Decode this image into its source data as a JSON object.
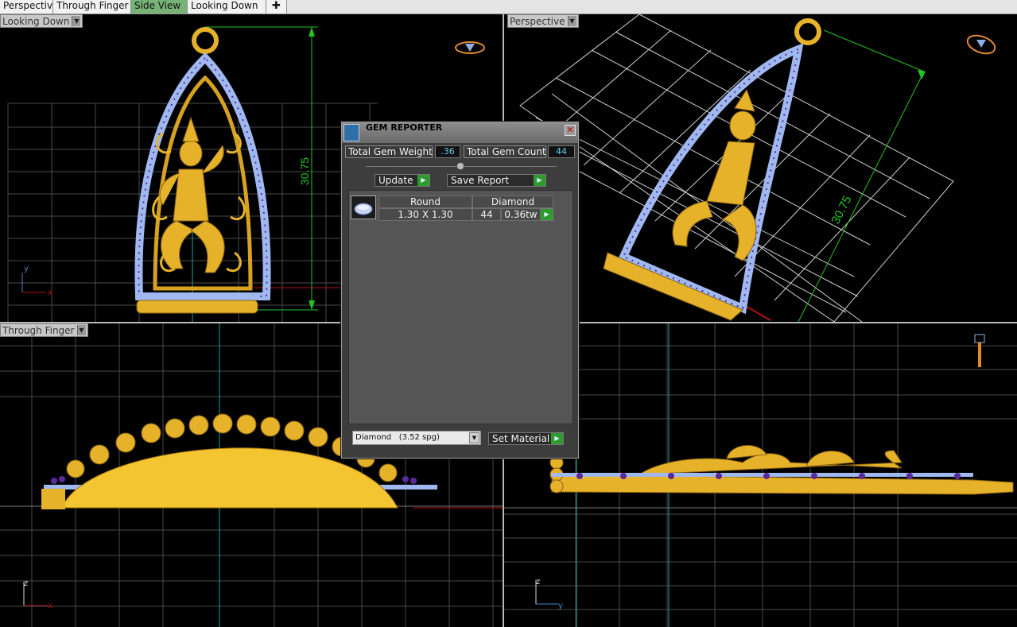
{
  "tabs": [
    {
      "label": "Perspective",
      "active": false
    },
    {
      "label": "Through Finger",
      "active": false
    },
    {
      "label": "Side View",
      "active": true
    },
    {
      "label": "Looking Down",
      "active": false
    }
  ],
  "viewports": {
    "top_left": {
      "label": "Looking Down",
      "dimension": "30.75",
      "axes": [
        "y",
        "x"
      ]
    },
    "top_right": {
      "label": "Perspective",
      "dimension": "30.75"
    },
    "bottom_left": {
      "label": "Through Finger",
      "axes": [
        "z",
        "x"
      ]
    },
    "bottom_right": {
      "axes": [
        "z",
        "y"
      ]
    }
  },
  "gem_reporter": {
    "title": "GEM REPORTER",
    "total_weight_label": "Total Gem Weight",
    "total_weight_value": ".36",
    "total_count_label": "Total Gem Count",
    "total_count_value": "44",
    "update_label": "Update",
    "save_report_label": "Save Report",
    "rows": [
      {
        "shape": "Round",
        "material": "Diamond",
        "size": "1.30 X 1.30",
        "count": "44",
        "weight": "0.36tw"
      }
    ],
    "material_select": "Diamond   (3.52 spg)",
    "set_material_label": "Set Material"
  },
  "colors": {
    "gold": "#e6b22a",
    "gem_blue": "#9fb8f0",
    "prong_purple": "#5a2a9a",
    "dimension_green": "#22c422",
    "active_tab": "#77b277"
  }
}
